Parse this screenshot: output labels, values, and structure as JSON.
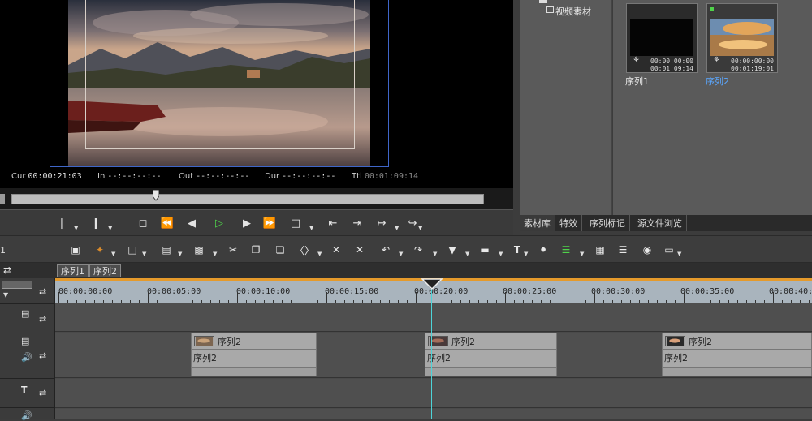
{
  "preview": {
    "cur_label": "Cur",
    "cur_value": "00:00:21:03",
    "in_label": "In",
    "in_value": "--:--:--:--",
    "out_label": "Out",
    "out_value": "--:--:--:--",
    "dur_label": "Dur",
    "dur_value": "--:--:--:--",
    "ttl_label": "Ttl",
    "ttl_value": "00:01:09:14"
  },
  "bin": {
    "tree_item": "视频素材",
    "clips": [
      {
        "label": "序列1",
        "tc_in": "00:00:00:00",
        "tc_dur": "00:01:09:14",
        "selected": false
      },
      {
        "label": "序列2",
        "tc_in": "00:00:00:00",
        "tc_dur": "00:01:19:01",
        "selected": true
      }
    ],
    "tabs": [
      "素材库",
      "特效",
      "序列标记",
      "源文件浏览"
    ]
  },
  "toolbar_left_label": "1",
  "sequence_tabs": [
    "序列1",
    "序列2"
  ],
  "ruler": {
    "labels": [
      "00:00:00:00",
      "00:00:05:00",
      "00:00:10:00",
      "00:00:15:00",
      "00:00:20:00",
      "00:00:25:00",
      "00:00:30:00",
      "00:00:35:00",
      "00:00:40:0"
    ]
  },
  "timeline": {
    "clips": [
      {
        "video_label": "序列2",
        "audio_label": "序列2"
      },
      {
        "video_label": "序列2",
        "audio_label": "序列2"
      },
      {
        "video_label": "序列2",
        "audio_label": "序列2"
      }
    ]
  },
  "colors": {
    "accent_blue": "#3f66c9",
    "play_green": "#4fd24a",
    "playhead": "#4dd4d8",
    "selected_label": "#5aa7ff"
  }
}
